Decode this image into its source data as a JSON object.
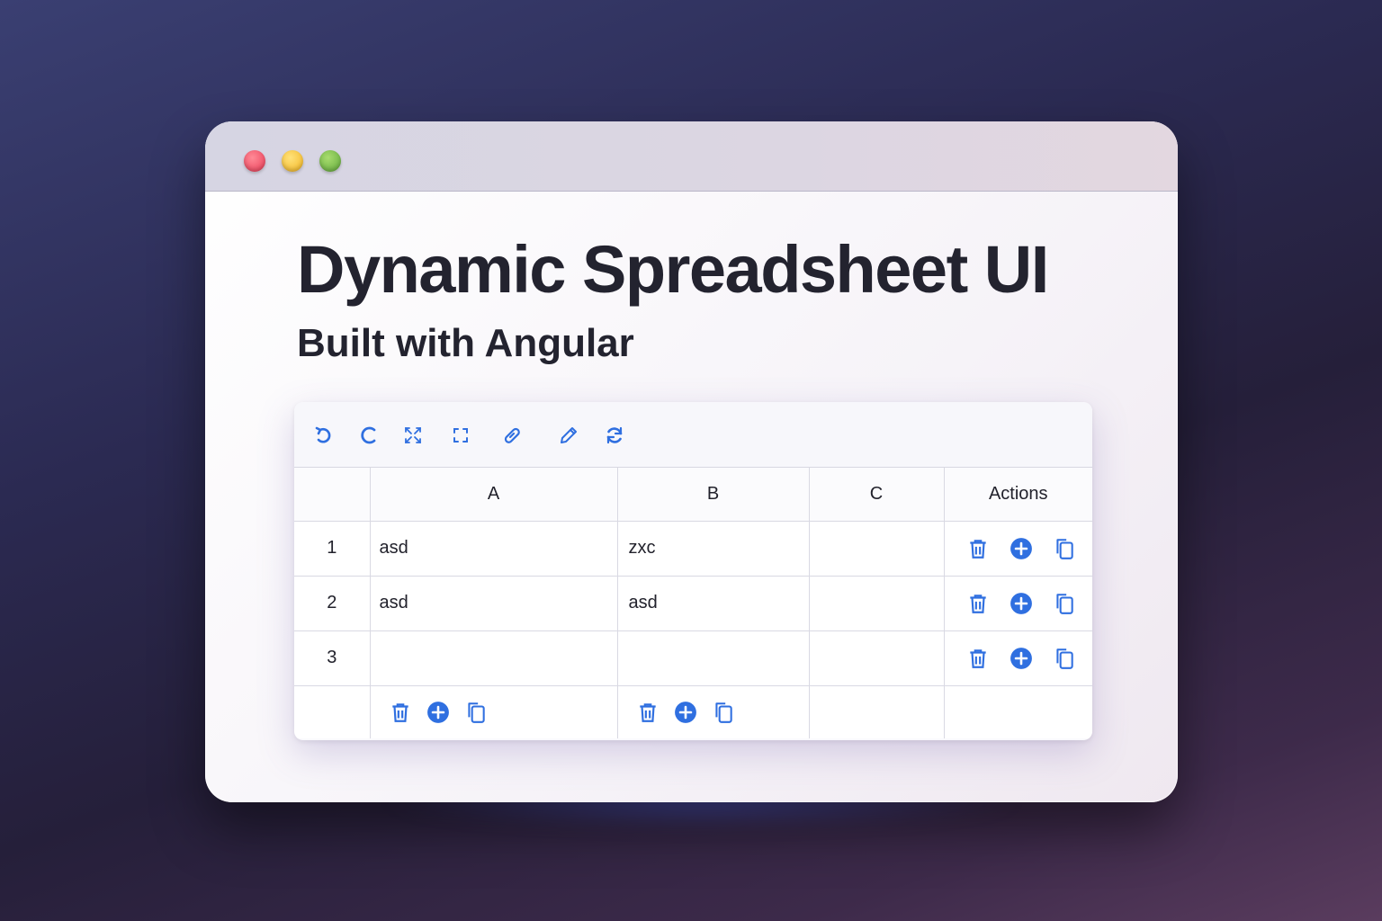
{
  "window": {
    "controls": [
      "close",
      "minimize",
      "maximize"
    ]
  },
  "heading": {
    "title": "Dynamic Spreadsheet UI",
    "subtitle": "Built with Angular"
  },
  "toolbar": {
    "buttons": [
      "undo-icon",
      "redo-icon",
      "collapse-icon",
      "expand-icon",
      "link-icon",
      "edit-icon",
      "refresh-icon"
    ]
  },
  "table": {
    "columns": [
      "",
      "A",
      "B",
      "C",
      "Actions"
    ],
    "rows": [
      {
        "num": "1",
        "a": "asd",
        "b": "zxc",
        "c": ""
      },
      {
        "num": "2",
        "a": "asd",
        "b": "asd",
        "c": ""
      },
      {
        "num": "3",
        "a": "",
        "b": "",
        "c": ""
      }
    ],
    "row_actions": [
      "trash-icon",
      "plus-circle-icon",
      "copy-icon"
    ],
    "column_actions": [
      "trash-icon",
      "plus-circle-icon",
      "copy-icon"
    ]
  },
  "colors": {
    "accent": "#2f6fe0",
    "title_text": "#23232f"
  }
}
